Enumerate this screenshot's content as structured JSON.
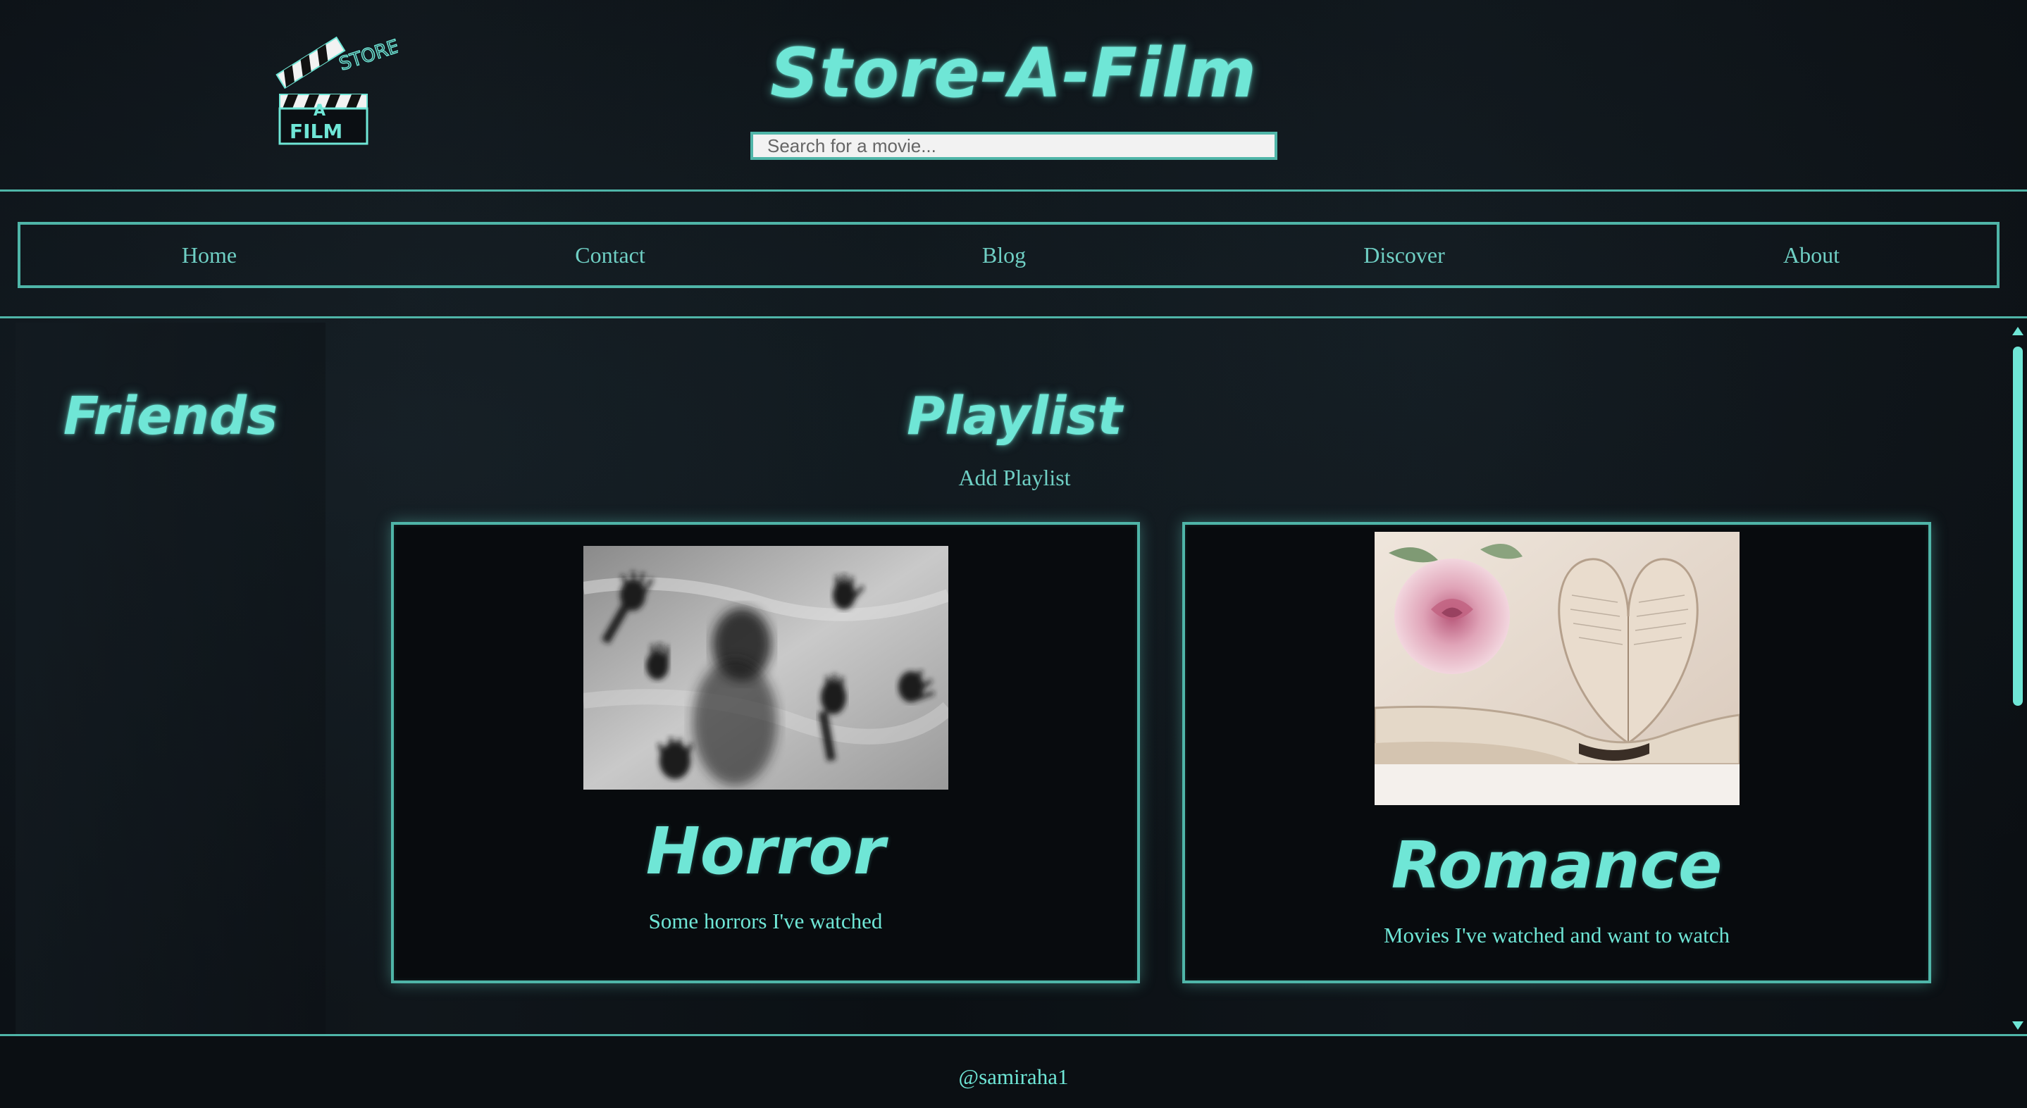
{
  "header": {
    "logo": {
      "icon": "clapperboard-logo-icon",
      "top_text": "STORE",
      "middle_text": "A",
      "bottom_text": "FILM"
    },
    "title": "Store-A-Film",
    "search": {
      "placeholder": "Search for a movie...",
      "value": ""
    }
  },
  "nav": {
    "items": [
      {
        "label": "Home"
      },
      {
        "label": "Contact"
      },
      {
        "label": "Blog"
      },
      {
        "label": "Discover"
      },
      {
        "label": "About"
      }
    ]
  },
  "sidebar": {
    "title": "Friends"
  },
  "playlist": {
    "title": "Playlist",
    "add_label": "Add Playlist",
    "cards": [
      {
        "title": "Horror",
        "description": "Some horrors I've watched",
        "image": "hands-behind-sheet-image"
      },
      {
        "title": "Romance",
        "description": "Movies I've watched and want to watch",
        "image": "rose-and-heart-book-image"
      }
    ]
  },
  "footer": {
    "handle": "@samiraha1"
  },
  "colors": {
    "accent": "#6fe6d6",
    "border": "#4fb5a8",
    "background": "#0b0f13"
  }
}
